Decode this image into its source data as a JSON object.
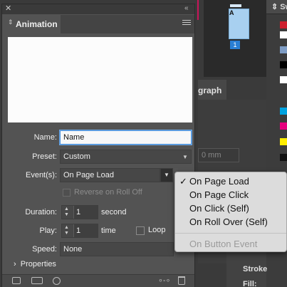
{
  "background": {
    "page_thumbnail_letter": "A",
    "page_number": "1",
    "swatches_title": "Sw",
    "paragraph_tab": "graph",
    "paragraph_field": "0 mm",
    "stroke_label": "Stroke",
    "fill_label": "Fill:",
    "swatch_colors": [
      "#cc1f2e",
      "#ffffff",
      "#7e9cc4",
      "#000000",
      "#ffffff",
      "#00a3e0",
      "#e6007e",
      "#ffed00",
      "#111111",
      "#cc1f2e"
    ]
  },
  "panel": {
    "title": "Animation",
    "name_label": "Name:",
    "name_value": "Name",
    "preset_label": "Preset:",
    "preset_value": "Custom",
    "events_label": "Event(s):",
    "events_value": "On Page Load",
    "reverse_label": "Reverse on Roll Off",
    "duration_label": "Duration:",
    "duration_value": "1",
    "duration_unit": "second",
    "play_label": "Play:",
    "play_value": "1",
    "play_unit": "time",
    "loop_label": "Loop",
    "speed_label": "Speed:",
    "speed_value": "None",
    "properties_label": "Properties"
  },
  "menu": {
    "checkmark": "✓",
    "items": [
      "On Page Load",
      "On Page Click",
      "On Click (Self)",
      "On Roll Over (Self)"
    ],
    "disabled_item": "On Button Event"
  },
  "icons": {
    "close": "✕",
    "collapse": "«",
    "tab_arrows": "⇕",
    "dropdown": "▼",
    "expand": "›",
    "path": "∘-∘"
  }
}
